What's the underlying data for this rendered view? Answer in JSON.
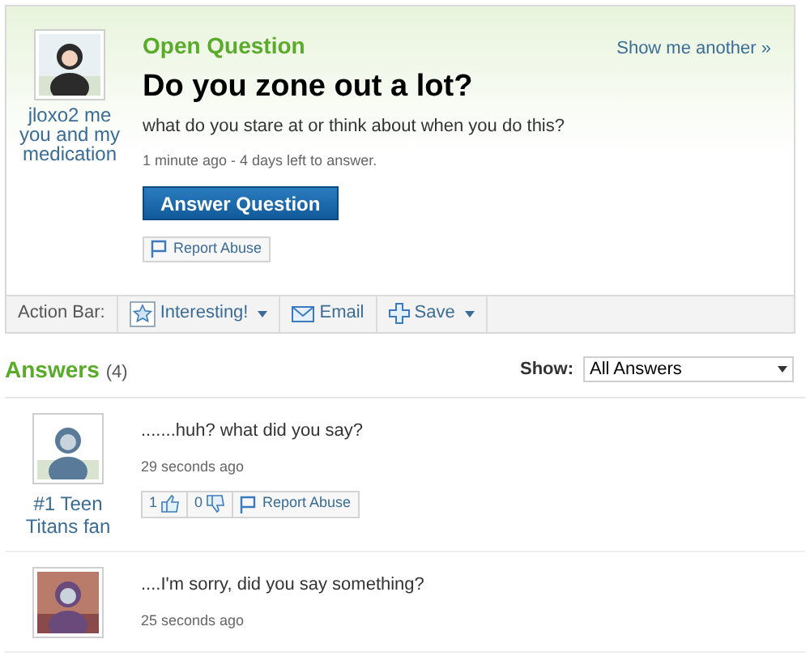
{
  "question": {
    "user": "jloxo2 me you and my medication",
    "status": "Open Question",
    "show_another": "Show me another »",
    "title": "Do you zone out a lot?",
    "details": "what do you stare at or think about when you do this?",
    "meta": "1 minute ago - 4 days left to answer.",
    "answer_button": "Answer Question",
    "report_button": "Report Abuse"
  },
  "action_bar": {
    "label": "Action Bar:",
    "items": [
      {
        "kind": "star",
        "label": "Interesting!",
        "dropdown": true
      },
      {
        "kind": "email",
        "label": "Email",
        "dropdown": false
      },
      {
        "kind": "save",
        "label": "Save",
        "dropdown": true
      }
    ]
  },
  "answers": {
    "title": "Answers",
    "count": "(4)",
    "filter_label": "Show:",
    "filter_value": "All Answers",
    "items": [
      {
        "user": "#1 Teen Titans fan",
        "text": ".......huh? what did you say?",
        "time": "29 seconds ago",
        "thumbs_up": "1",
        "thumbs_down": "0",
        "report": "Report Abuse"
      },
      {
        "text": "....I'm sorry, did you say something?",
        "time": "25 seconds ago"
      }
    ]
  }
}
